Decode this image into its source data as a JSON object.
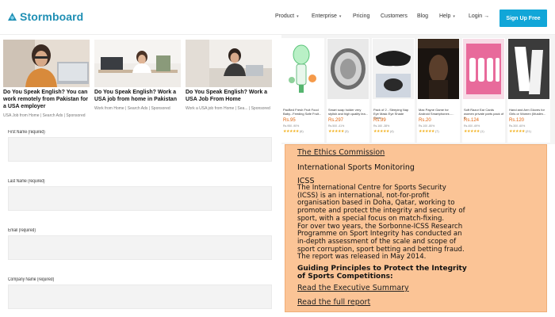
{
  "header": {
    "logo_text": "Stormboard",
    "nav": [
      {
        "label": "Product",
        "caret": "▾"
      },
      {
        "label": "Enterprise",
        "caret": "▾"
      },
      {
        "label": "Pricing"
      },
      {
        "label": "Customers"
      },
      {
        "label": "Blog"
      },
      {
        "label": "Help",
        "caret": "▾"
      },
      {
        "label": "Login →"
      }
    ],
    "signup_label": "Sign Up Free"
  },
  "ads": [
    {
      "title": "Do You Speak English? You can work remotely from Pakistan for a USA employer",
      "source": "USA Job from Home",
      "sep": "|",
      "cta": "Search Ads",
      "sponsored": "Sponsored"
    },
    {
      "title": "Do You Speak English? Work a USA job from home in Pakistan",
      "source": "Work from Home",
      "sep": "|",
      "cta": "Search Ads",
      "sponsored": "Sponsored"
    },
    {
      "title": "Do You Speak English? Work a USA Job From Home",
      "source": "Work a USA job from Home",
      "sep": "|",
      "cta": "Sea...",
      "sponsored": "Sponsored"
    }
  ],
  "form": {
    "fields": [
      {
        "label": "First Name (required)",
        "value": ""
      },
      {
        "label": "Last Name (required)",
        "value": ""
      },
      {
        "label": "Email (required)",
        "value": ""
      },
      {
        "label": "Company Name (required)",
        "value": ""
      }
    ]
  },
  "products": [
    {
      "title": "PacBed Fresh Fruit Food Baby...Feeding Safe Fruit...",
      "price": "Rs.95",
      "old_price": "Rs.950 -90%",
      "stars": "★★★★★",
      "count": "(6)"
    },
    {
      "title": "Smart soap holder very stylish and high quality lea...",
      "price": "Rs.297",
      "old_price": "Rs.500 -41%",
      "stars": "★★★★★",
      "count": "(3)"
    },
    {
      "title": "Pack of 2 - Sleeping Nap Eye Mask Eye Shade Cove...",
      "price": "Rs.99",
      "old_price": "Rs.160 -38%",
      "stars": "★★★★★",
      "count": "(4)"
    },
    {
      "title": "Max Payne Game for Android Smartphones -...",
      "price": "Rs.20",
      "old_price": "Rs.100 -80%",
      "stars": "★★★★★",
      "count": "(7)"
    },
    {
      "title": "Soft Razor Ear Cards women private parts pack of 6",
      "price": "Rs.124",
      "old_price": "Rs.400 -69%",
      "stars": "★★★★★",
      "count": "(1)"
    },
    {
      "title": "Hand and Arm Gloves for Girls or Women (Muslim...",
      "price": "Rs.120",
      "old_price": "Rs.300 -60%",
      "stars": "★★★★★",
      "count": "(21)"
    }
  ],
  "infobox": {
    "link_top": "The Ethics Commission",
    "subtitle": "International Sports Monitoring",
    "acronym": "ICSS",
    "paragraph_lines": [
      "The International Centre for Sports Security",
      "(ICSS) is an international, not-for-profit",
      "organisation based in Doha, Qatar, working to",
      "promote and protect the integrity and security of",
      "sport, with a special focus on match-fixing.",
      "For over two years, the Sorbonne-ICSS Research",
      "Programme on Sport Integrity has conducted an",
      "in-depth assessment of the scale and scope of",
      "sport corruption, sport betting and betting fraud.",
      "The report was released in May 2014."
    ],
    "principles_lines": [
      "Guiding Principles to Protect the Integrity",
      "of Sports Competitions:"
    ],
    "link_exec": "Read the Executive Summary",
    "link_full": "Read the full report"
  },
  "colors": {
    "brand": "#1f8fb4",
    "signup_bg": "#11a6d8",
    "infobox_bg": "#fbc496",
    "price": "#e0640c",
    "stars": "#f2b01e"
  }
}
